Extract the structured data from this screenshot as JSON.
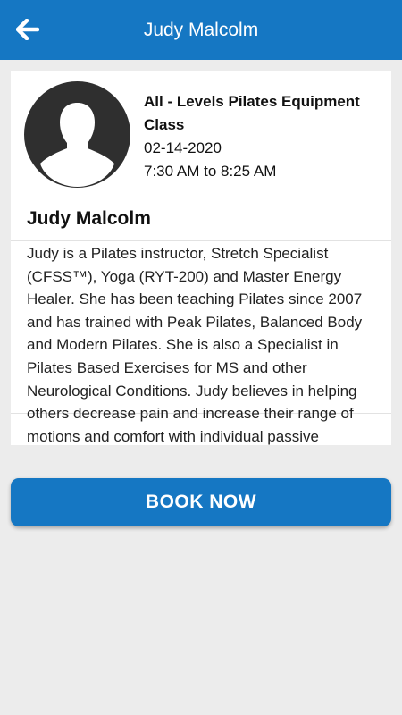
{
  "header": {
    "title": "Judy Malcolm",
    "back_icon": "arrow-left-icon"
  },
  "class": {
    "name": "All - Levels Pilates Equipment Class",
    "date": "02-14-2020",
    "time": "7:30 AM to 8:25 AM"
  },
  "instructor": {
    "avatar_icon": "person-silhouette-icon",
    "name": "Judy Malcolm",
    "bio": "Judy is a Pilates instructor, Stretch Specialist (CFSS™), Yoga (RYT-200) and Master Energy Healer. She has been teaching Pilates since 2007 and has trained with Peak Pilates, Balanced Body and Modern Pilates. She is also a Specialist in Pilates Based Exercises for MS and other Neurological Conditions. Judy believes in helping others decrease pain and increase their range of motions and comfort with individual passive stretching (Fascial Stretch Therapy™) and"
  },
  "actions": {
    "book_label": "BOOK NOW"
  },
  "colors": {
    "primary": "#1577c3",
    "background": "#ececec"
  }
}
